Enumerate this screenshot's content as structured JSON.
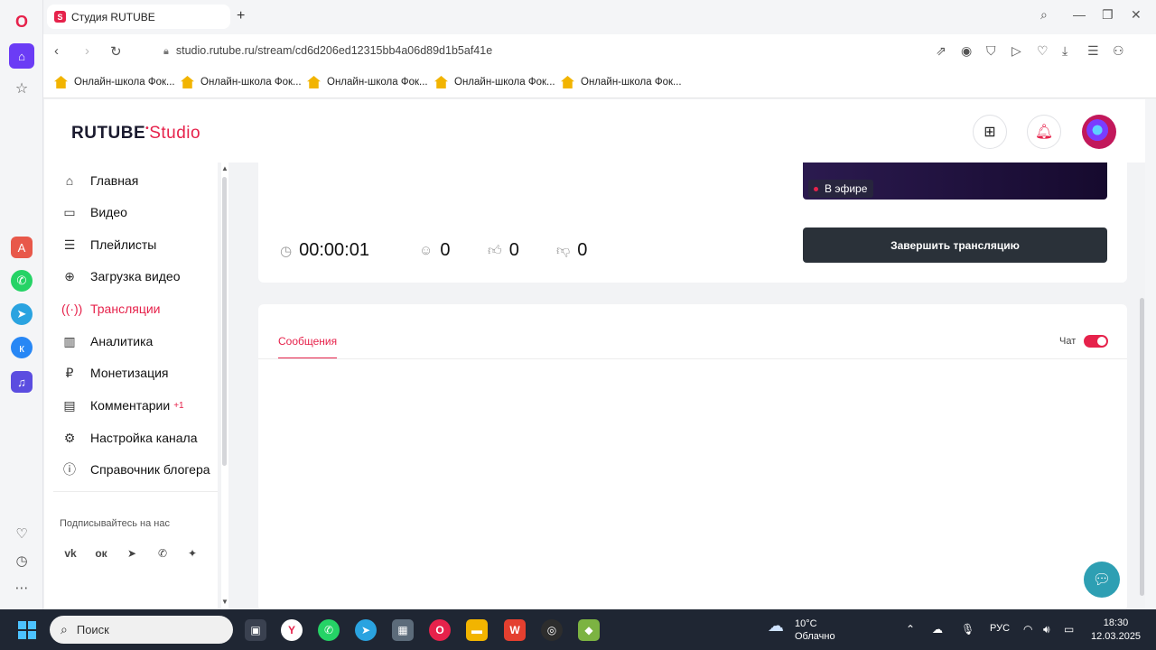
{
  "browser": {
    "tab_title": "Студия RUTUBE",
    "tab_favicon": "S",
    "url": "studio.rutube.ru/stream/cd6d206ed12315bb4a06d89d1b5af41e",
    "bookmarks": [
      "Онлайн-школа Фок...",
      "Онлайн-школа Фок...",
      "Онлайн-школа Фок...",
      "Онлайн-школа Фок...",
      "Онлайн-школа Фок..."
    ]
  },
  "header": {
    "logo_main": "RUTUBE",
    "logo_studio": "Studio"
  },
  "sidebar": {
    "items": [
      {
        "label": "Главная",
        "icon": "home-icon"
      },
      {
        "label": "Видео",
        "icon": "video-icon"
      },
      {
        "label": "Плейлисты",
        "icon": "playlist-icon"
      },
      {
        "label": "Загрузка видео",
        "icon": "upload-icon"
      },
      {
        "label": "Трансляции",
        "icon": "broadcast-icon",
        "active": true
      },
      {
        "label": "Аналитика",
        "icon": "analytics-icon"
      },
      {
        "label": "Монетизация",
        "icon": "ruble-icon"
      },
      {
        "label": "Комментарии",
        "icon": "comment-icon",
        "badge": "+1"
      },
      {
        "label": "Настройка канала",
        "icon": "gear-icon"
      },
      {
        "label": "Справочник блогера",
        "icon": "info-icon"
      }
    ],
    "follow_label": "Подписывайтесь на нас",
    "social": [
      "vk-icon",
      "ok-icon",
      "telegram-icon",
      "viber-icon",
      "dzen-icon"
    ]
  },
  "stream": {
    "live_label": "В эфире",
    "duration": "00:00:01",
    "viewers": "0",
    "likes": "0",
    "dislikes": "0",
    "end_button": "Завершить трансляцию"
  },
  "chat": {
    "tab_label": "Сообщения",
    "toggle_label": "Чат",
    "toggle_on": true
  },
  "taskbar": {
    "search_placeholder": "Поиск",
    "weather_temp": "10°C",
    "weather_desc": "Облачно",
    "language": "РУС",
    "time": "18:30",
    "date": "12.03.2025"
  },
  "colors": {
    "accent": "#e6224b",
    "dark_button": "#2a3139",
    "taskbar": "#1f2633"
  }
}
